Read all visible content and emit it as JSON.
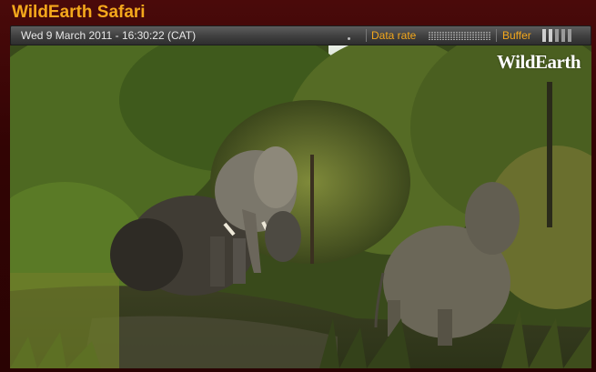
{
  "app": {
    "title": "WildEarth Safari"
  },
  "status": {
    "datetime": "Wed 9 March 2011 - 16:30:22 (CAT)",
    "data_rate_label": "Data rate",
    "buffer_label": "Buffer"
  },
  "video": {
    "logo_text": "WildEarth"
  },
  "colors": {
    "accent": "#f4a81c",
    "frame": "#3a0606",
    "statusbar": "#474747"
  }
}
